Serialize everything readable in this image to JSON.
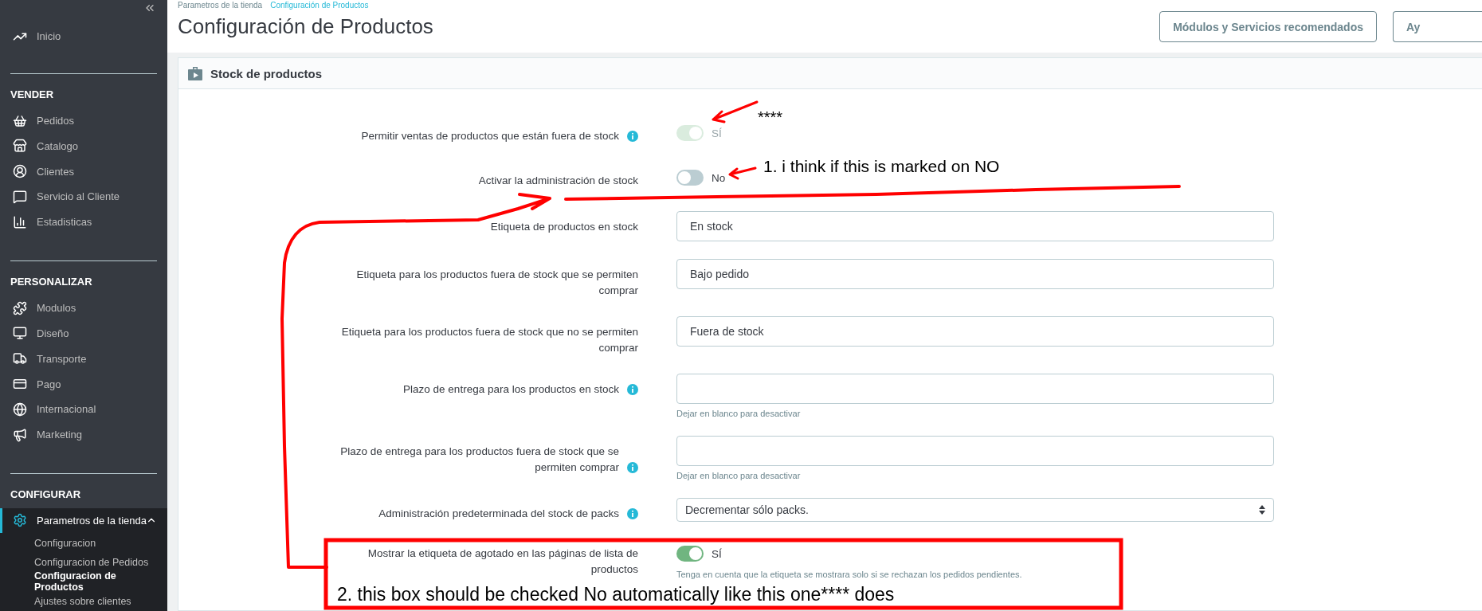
{
  "sidebar": {
    "top": [
      {
        "label": "Inicio"
      }
    ],
    "sections": [
      {
        "title": "VENDER",
        "items": [
          {
            "label": "Pedidos",
            "selected": false
          },
          {
            "label": "Catalogo",
            "selected": false
          },
          {
            "label": "Clientes",
            "selected": false
          },
          {
            "label": "Servicio al Cliente",
            "selected": false
          },
          {
            "label": "Estadisticas",
            "selected": false
          }
        ]
      },
      {
        "title": "PERSONALIZAR",
        "items": [
          {
            "label": "Modulos",
            "selected": false
          },
          {
            "label": "Diseño",
            "selected": false
          },
          {
            "label": "Transporte",
            "selected": false
          },
          {
            "label": "Pago",
            "selected": false
          },
          {
            "label": "Internacional",
            "selected": false
          },
          {
            "label": "Marketing",
            "selected": false
          }
        ]
      },
      {
        "title": "CONFIGURAR",
        "items": [
          {
            "label": "Parametros de la tienda",
            "selected": true,
            "expanded": true,
            "children": [
              {
                "label": "Configuracion",
                "selected": false
              },
              {
                "label": "Configuracion de Pedidos",
                "selected": false
              },
              {
                "label": "Configuracion de Productos",
                "selected": true
              },
              {
                "label": "Ajustes sobre clientes",
                "selected": false
              }
            ]
          }
        ]
      }
    ]
  },
  "breadcrumb": [
    {
      "label": "Parametros de la tienda",
      "kind": "text"
    },
    {
      "label": "Configuración de Productos",
      "kind": "link"
    }
  ],
  "page_title": "Configuración de Productos",
  "header_buttons": [
    "Módulos y Servicios recomendados",
    "Ay"
  ],
  "card": {
    "title": "Stock de productos",
    "rows": [
      {
        "kind": "toggle",
        "label": "Permitir ventas de productos que están fuera de stock",
        "info": true,
        "on": true,
        "disabled": true,
        "value": "SÍ"
      },
      {
        "kind": "toggle",
        "label": "Activar la administración de stock",
        "on": false,
        "disabled": false,
        "value": "No"
      },
      {
        "kind": "text",
        "label": "Etiqueta de productos en stock",
        "value": "En stock"
      },
      {
        "kind": "text",
        "label": "Etiqueta para los productos fuera de stock que se permiten comprar",
        "value": "Bajo pedido"
      },
      {
        "kind": "text",
        "label": "Etiqueta para los productos fuera de stock que no se permiten comprar",
        "value": "Fuera de stock"
      },
      {
        "kind": "text",
        "label": "Plazo de entrega para los productos en stock",
        "info": true,
        "hint": "Dejar en blanco para desactivar"
      },
      {
        "kind": "text",
        "label": "Plazo de entrega para los productos fuera de stock que se permiten comprar",
        "info": true,
        "hint": "Dejar en blanco para desactivar"
      },
      {
        "kind": "select",
        "label": "Administración predeterminada del stock de packs",
        "info": true,
        "value": "Decrementar sólo packs."
      },
      {
        "kind": "toggle",
        "label": "Mostrar la etiqueta de agotado en las páginas de lista de productos",
        "on": true,
        "disabled": false,
        "value": "SÍ",
        "hint": "Tenga en cuenta que la etiqueta se mostrara solo si se rechazan los pedidos pendientes."
      }
    ]
  },
  "annotations": [
    {
      "kind": "mark",
      "text": "****"
    },
    {
      "kind": "note",
      "text": "1. i think if this is marked on NO"
    },
    {
      "kind": "note",
      "text": "2. this box should be checked No automatically like this one**** does"
    }
  ]
}
